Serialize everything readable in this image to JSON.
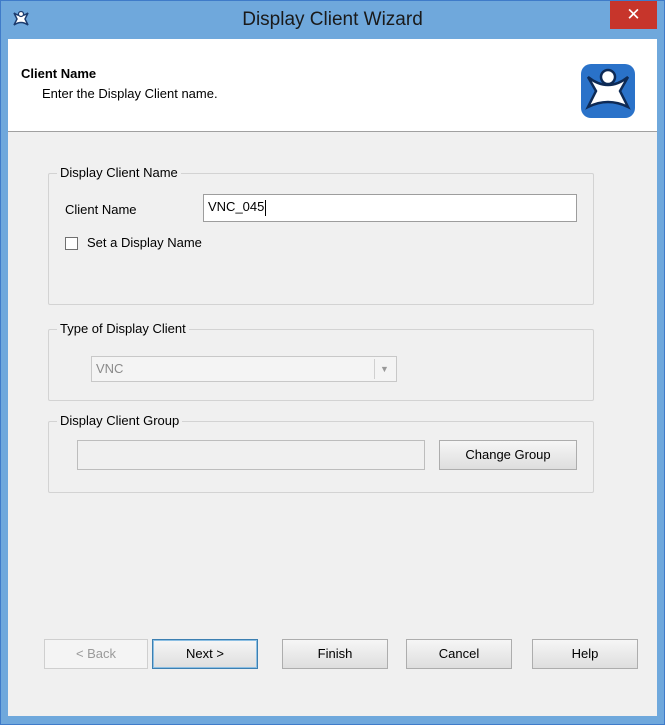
{
  "window": {
    "title": "Display Client Wizard",
    "close_glyph": "✕"
  },
  "header": {
    "title": "Client Name",
    "subtitle": "Enter the Display Client name."
  },
  "name_group": {
    "label": "Display Client Name",
    "client_name_label": "Client Name",
    "client_name_value": "VNC_045",
    "set_display_name_label": "Set a Display Name",
    "set_display_name_checked": false
  },
  "type_group": {
    "label": "Type of Display Client",
    "selected": "VNC"
  },
  "group_group": {
    "label": "Display Client Group",
    "value": "",
    "change_button": "Change Group"
  },
  "footer": {
    "back": "< Back",
    "next": "Next >",
    "finish": "Finish",
    "cancel": "Cancel",
    "help": "Help"
  },
  "icons": {
    "app": "thinmanager-icon",
    "logo": "thinmanager-logo-icon",
    "close": "close-icon",
    "dropdown": "chevron-down-icon"
  },
  "colors": {
    "titlebar": "#6fa8dc",
    "close_button": "#c7352b",
    "logo_blue": "#2a72c9"
  }
}
